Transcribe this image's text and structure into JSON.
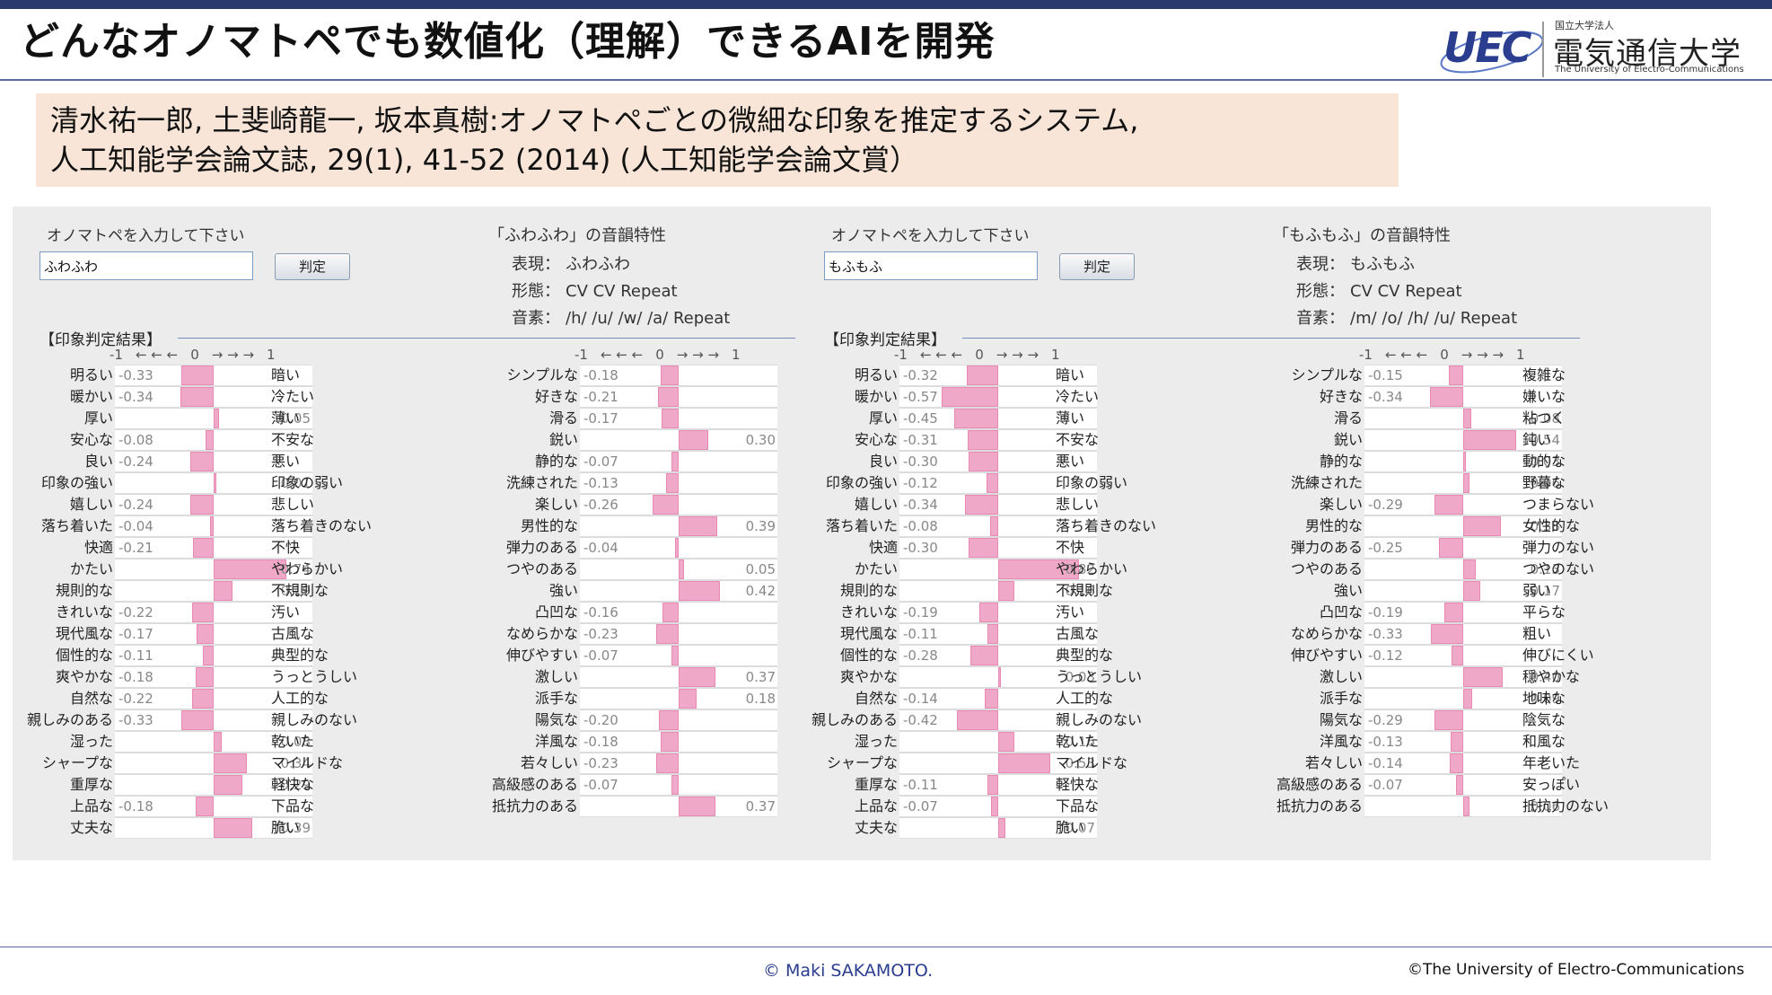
{
  "slide": {
    "title": "どんなオノマトペでも数値化（理解）できるAIを開発",
    "citation_line1": "清水祐一郎, 土斐崎龍一, 坂本真樹:オノマトペごとの微細な印象を推定するシステム,",
    "citation_line2": "人工知能学会論文誌, 29(1), 41-52 (2014) (人工知能学会論文賞）",
    "footer_left": "© Maki SAKAMOTO.",
    "footer_right": "©The University of Electro-Communications"
  },
  "logo": {
    "mark": "UEC",
    "ja_small": "国立大学法人",
    "ja_name": "電気通信大学",
    "en_name": "The University of Electro-Communications"
  },
  "colors": {
    "bar": "#f0a8c8",
    "panel_bg": "#ececec",
    "citation_bg": "#f8e5d7",
    "header_bar": "#2b3a6e"
  },
  "panels": [
    {
      "input_label": "オノマトペを入力して下さい",
      "input_value": "ふわふわ",
      "button_label": "判定",
      "phon_title": "「ふわふわ」の音韻特性",
      "phon_rows": [
        {
          "key": "表現：",
          "value": "ふわふわ"
        },
        {
          "key": "形態：",
          "value": "CV CV  Repeat"
        },
        {
          "key": "音素：",
          "value": "/h/ /u/ /w/ /a/  Repeat"
        }
      ],
      "result_label": "【印象判定結果】",
      "scale": {
        "neg": "-1",
        "zero": "0",
        "pos": "1",
        "left_arrows": "← ← ←",
        "right_arrows": "→ → →"
      },
      "columns": [
        [
          {
            "left": "明るい",
            "right": "暗い",
            "value": -0.33,
            "label": "-0.33"
          },
          {
            "left": "暖かい",
            "right": "冷たい",
            "value": -0.34,
            "label": "-0.34"
          },
          {
            "left": "厚い",
            "right": "薄い",
            "value": 0.05,
            "label": "0.05"
          },
          {
            "left": "安心な",
            "right": "不安な",
            "value": -0.08,
            "label": "-0.08"
          },
          {
            "left": "良い",
            "right": "悪い",
            "value": -0.24,
            "label": "-0.24"
          },
          {
            "left": "印象の強い",
            "right": "印象の弱い",
            "value": 0.01,
            "label": "0.01"
          },
          {
            "left": "嬉しい",
            "right": "悲しい",
            "value": -0.24,
            "label": "-0.24"
          },
          {
            "left": "落ち着いた",
            "right": "落ち着きのない",
            "value": -0.04,
            "label": "-0.04"
          },
          {
            "left": "快適",
            "right": "不快",
            "value": -0.21,
            "label": "-0.21"
          },
          {
            "left": "かたい",
            "right": "やわらかい",
            "value": 0.74,
            "label": "0.74"
          },
          {
            "left": "規則的な",
            "right": "不規則な",
            "value": 0.19,
            "label": "0.19"
          },
          {
            "left": "きれいな",
            "right": "汚い",
            "value": -0.22,
            "label": "-0.22"
          },
          {
            "left": "現代風な",
            "right": "古風な",
            "value": -0.17,
            "label": "-0.17"
          },
          {
            "left": "個性的な",
            "right": "典型的な",
            "value": -0.11,
            "label": "-0.11"
          },
          {
            "left": "爽やかな",
            "right": "うっとうしい",
            "value": -0.18,
            "label": "-0.18"
          },
          {
            "left": "自然な",
            "right": "人工的な",
            "value": -0.22,
            "label": "-0.22"
          },
          {
            "left": "親しみのある",
            "right": "親しみのない",
            "value": -0.33,
            "label": "-0.33"
          },
          {
            "left": "湿った",
            "right": "乾いた",
            "value": 0.08,
            "label": "0.08"
          },
          {
            "left": "シャープな",
            "right": "マイルドな",
            "value": 0.34,
            "label": "0.34"
          },
          {
            "left": "重厚な",
            "right": "軽快な",
            "value": 0.29,
            "label": "0.29"
          },
          {
            "left": "上品な",
            "right": "下品な",
            "value": -0.18,
            "label": "-0.18"
          },
          {
            "left": "丈夫な",
            "right": "脆い",
            "value": 0.39,
            "label": "0.39"
          }
        ],
        [
          {
            "left": "シンプルな",
            "right": "",
            "value": -0.18,
            "label": "-0.18"
          },
          {
            "left": "好きな",
            "right": "",
            "value": -0.21,
            "label": "-0.21"
          },
          {
            "left": "滑る",
            "right": "",
            "value": -0.17,
            "label": "-0.17"
          },
          {
            "left": "鋭い",
            "right": "",
            "value": 0.3,
            "label": "0.30"
          },
          {
            "left": "静的な",
            "right": "",
            "value": -0.07,
            "label": "-0.07"
          },
          {
            "left": "洗練された",
            "right": "",
            "value": -0.13,
            "label": "-0.13"
          },
          {
            "left": "楽しい",
            "right": "",
            "value": -0.26,
            "label": "-0.26"
          },
          {
            "left": "男性的な",
            "right": "",
            "value": 0.39,
            "label": "0.39"
          },
          {
            "left": "弾力のある",
            "right": "",
            "value": -0.04,
            "label": "-0.04"
          },
          {
            "left": "つやのある",
            "right": "",
            "value": 0.05,
            "label": "0.05"
          },
          {
            "left": "強い",
            "right": "",
            "value": 0.42,
            "label": "0.42"
          },
          {
            "left": "凸凹な",
            "right": "",
            "value": -0.16,
            "label": "-0.16"
          },
          {
            "left": "なめらかな",
            "right": "",
            "value": -0.23,
            "label": "-0.23"
          },
          {
            "left": "伸びやすい",
            "right": "",
            "value": -0.07,
            "label": "-0.07"
          },
          {
            "left": "激しい",
            "right": "",
            "value": 0.37,
            "label": "0.37"
          },
          {
            "left": "派手な",
            "right": "",
            "value": 0.18,
            "label": "0.18"
          },
          {
            "left": "陽気な",
            "right": "",
            "value": -0.2,
            "label": "-0.20"
          },
          {
            "left": "洋風な",
            "right": "",
            "value": -0.18,
            "label": "-0.18"
          },
          {
            "left": "若々しい",
            "right": "",
            "value": -0.23,
            "label": "-0.23"
          },
          {
            "left": "高級感のある",
            "right": "",
            "value": -0.07,
            "label": "-0.07"
          },
          {
            "left": "抵抗力のある",
            "right": "",
            "value": 0.37,
            "label": "0.37"
          }
        ]
      ]
    },
    {
      "input_label": "オノマトペを入力して下さい",
      "input_value": "もふもふ",
      "button_label": "判定",
      "phon_title": "「もふもふ」の音韻特性",
      "phon_rows": [
        {
          "key": "表現：",
          "value": "もふもふ"
        },
        {
          "key": "形態：",
          "value": "CV CV  Repeat"
        },
        {
          "key": "音素：",
          "value": "/m/ /o/ /h/ /u/  Repeat"
        }
      ],
      "result_label": "【印象判定結果】",
      "scale": {
        "neg": "-1",
        "zero": "0",
        "pos": "1",
        "left_arrows": "← ← ←",
        "right_arrows": "→ → →"
      },
      "columns": [
        [
          {
            "left": "明るい",
            "right": "暗い",
            "value": -0.32,
            "label": "-0.32"
          },
          {
            "left": "暖かい",
            "right": "冷たい",
            "value": -0.57,
            "label": "-0.57"
          },
          {
            "left": "厚い",
            "right": "薄い",
            "value": -0.45,
            "label": "-0.45"
          },
          {
            "left": "安心な",
            "right": "不安な",
            "value": -0.31,
            "label": "-0.31"
          },
          {
            "left": "良い",
            "right": "悪い",
            "value": -0.3,
            "label": "-0.30"
          },
          {
            "left": "印象の強い",
            "right": "印象の弱い",
            "value": -0.12,
            "label": "-0.12"
          },
          {
            "left": "嬉しい",
            "right": "悲しい",
            "value": -0.34,
            "label": "-0.34"
          },
          {
            "left": "落ち着いた",
            "right": "落ち着きのない",
            "value": -0.08,
            "label": "-0.08"
          },
          {
            "left": "快適",
            "right": "不快",
            "value": -0.3,
            "label": "-0.30"
          },
          {
            "left": "かたい",
            "right": "やわらかい",
            "value": 0.82,
            "label": "0.82"
          },
          {
            "left": "規則的な",
            "right": "不規則な",
            "value": 0.16,
            "label": "0.16"
          },
          {
            "left": "きれいな",
            "right": "汚い",
            "value": -0.19,
            "label": "-0.19"
          },
          {
            "left": "現代風な",
            "right": "古風な",
            "value": -0.11,
            "label": "-0.11"
          },
          {
            "left": "個性的な",
            "right": "典型的な",
            "value": -0.28,
            "label": "-0.28"
          },
          {
            "left": "爽やかな",
            "right": "うっとうしい",
            "value": 0.03,
            "label": "0.03"
          },
          {
            "left": "自然な",
            "right": "人工的な",
            "value": -0.14,
            "label": "-0.14"
          },
          {
            "left": "親しみのある",
            "right": "親しみのない",
            "value": -0.42,
            "label": "-0.42"
          },
          {
            "left": "湿った",
            "right": "乾いた",
            "value": 0.16,
            "label": "0.16"
          },
          {
            "left": "シャープな",
            "right": "マイルドな",
            "value": 0.53,
            "label": "0.53"
          },
          {
            "left": "重厚な",
            "right": "軽快な",
            "value": -0.11,
            "label": "-0.11"
          },
          {
            "left": "上品な",
            "right": "下品な",
            "value": -0.07,
            "label": "-0.07"
          },
          {
            "left": "丈夫な",
            "right": "脆い",
            "value": 0.07,
            "label": "0.07"
          }
        ],
        [
          {
            "left": "シンプルな",
            "right": "複雑な",
            "value": -0.15,
            "label": "-0.15"
          },
          {
            "left": "好きな",
            "right": "嫌いな",
            "value": -0.34,
            "label": "-0.34"
          },
          {
            "left": "滑る",
            "right": "粘つく",
            "value": 0.08,
            "label": "0.08"
          },
          {
            "left": "鋭い",
            "right": "鈍い",
            "value": 0.54,
            "label": "0.54"
          },
          {
            "left": "静的な",
            "right": "動的な",
            "value": 0.03,
            "label": "0.03"
          },
          {
            "left": "洗練された",
            "right": "野暮な",
            "value": 0.06,
            "label": "0.06"
          },
          {
            "left": "楽しい",
            "right": "つまらない",
            "value": -0.29,
            "label": "-0.29"
          },
          {
            "left": "男性的な",
            "right": "女性的な",
            "value": 0.38,
            "label": "0.38"
          },
          {
            "left": "弾力のある",
            "right": "弾力のない",
            "value": -0.25,
            "label": "-0.25"
          },
          {
            "left": "つやのある",
            "right": "つやのない",
            "value": 0.13,
            "label": "0.13"
          },
          {
            "left": "強い",
            "right": "弱い",
            "value": 0.17,
            "label": "0.17"
          },
          {
            "left": "凸凹な",
            "right": "平らな",
            "value": -0.19,
            "label": "-0.19"
          },
          {
            "left": "なめらかな",
            "right": "粗い",
            "value": -0.33,
            "label": "-0.33"
          },
          {
            "left": "伸びやすい",
            "right": "伸びにくい",
            "value": -0.12,
            "label": "-0.12"
          },
          {
            "left": "激しい",
            "right": "穏やかな",
            "value": 0.4,
            "label": "0.40"
          },
          {
            "left": "派手な",
            "right": "地味な",
            "value": 0.09,
            "label": "0.09"
          },
          {
            "left": "陽気な",
            "right": "陰気な",
            "value": -0.29,
            "label": "-0.29"
          },
          {
            "left": "洋風な",
            "right": "和風な",
            "value": -0.13,
            "label": "-0.13"
          },
          {
            "left": "若々しい",
            "right": "年老いた",
            "value": -0.14,
            "label": "-0.14"
          },
          {
            "left": "高級感のある",
            "right": "安っぽい",
            "value": -0.07,
            "label": "-0.07"
          },
          {
            "left": "抵抗力のある",
            "right": "抵抗力のない",
            "value": 0.06,
            "label": "0.06"
          }
        ]
      ]
    }
  ]
}
